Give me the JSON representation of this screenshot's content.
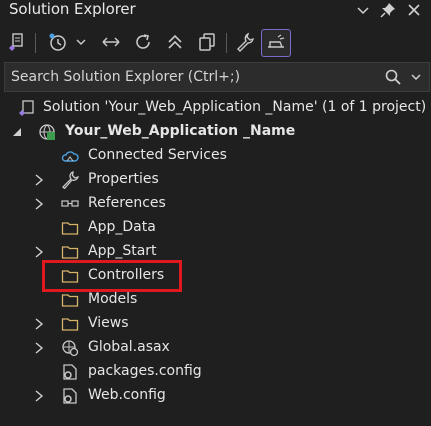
{
  "panel": {
    "title": "Solution Explorer",
    "title_icons": [
      "chevron-down-icon",
      "pin-icon",
      "close-icon"
    ]
  },
  "toolbar": {
    "icons": [
      "switch-views-icon",
      "history-icon",
      "chevron-down-icon",
      "sync-icon",
      "refresh-icon",
      "collapse-all-icon",
      "show-all-files-icon",
      "properties-wrench-icon",
      "preview-selected-icon"
    ],
    "active_icon": "preview-selected-icon"
  },
  "search": {
    "placeholder": "Search Solution Explorer (Ctrl+;)",
    "icons": [
      "search-icon",
      "chevron-down-icon"
    ]
  },
  "tree": {
    "solution": "Solution 'Your_Web_Application _Name' (1 of 1 project)",
    "project": "Your_Web_Application _Name",
    "items": [
      {
        "label": "Connected Services",
        "icon": "cloud-icon",
        "expandable": false
      },
      {
        "label": "Properties",
        "icon": "wrench-icon",
        "expandable": true
      },
      {
        "label": "References",
        "icon": "references-icon",
        "expandable": true
      },
      {
        "label": "App_Data",
        "icon": "folder-icon",
        "expandable": false
      },
      {
        "label": "App_Start",
        "icon": "folder-icon",
        "expandable": true
      },
      {
        "label": "Controllers",
        "icon": "folder-icon",
        "expandable": false
      },
      {
        "label": "Models",
        "icon": "folder-icon",
        "expandable": false
      },
      {
        "label": "Views",
        "icon": "folder-icon",
        "expandable": true
      },
      {
        "label": "Global.asax",
        "icon": "global-asax-icon",
        "expandable": true
      },
      {
        "label": "packages.config",
        "icon": "config-file-icon",
        "expandable": false
      },
      {
        "label": "Web.config",
        "icon": "config-file-icon",
        "expandable": true
      }
    ]
  },
  "annotation": {
    "highlight_color": "#e0191f",
    "highlighted_item": "Controllers"
  },
  "colors": {
    "background": "#1f1f1f",
    "text": "#e6e6e6",
    "folder": "#d8b46a",
    "accent": "#7b6ad0"
  }
}
